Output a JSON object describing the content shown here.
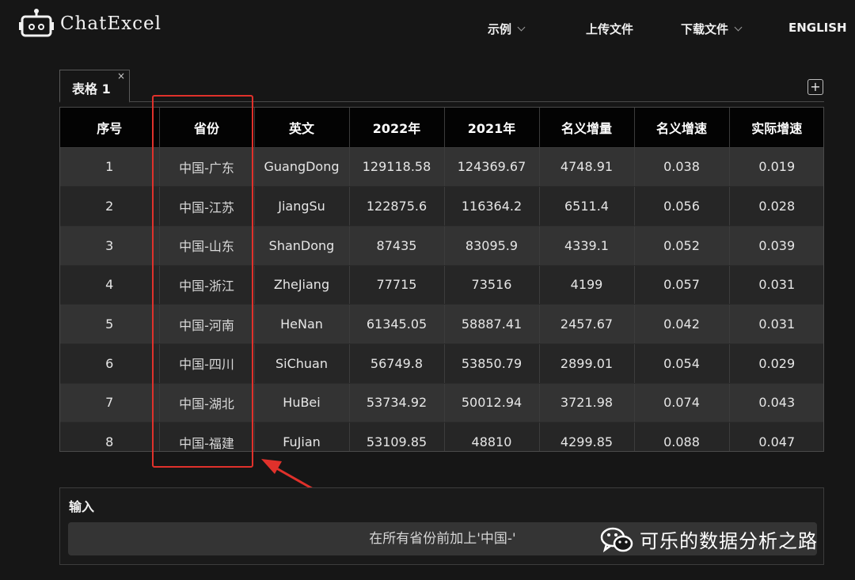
{
  "app": {
    "title": "ChatExcel"
  },
  "nav": {
    "examples": "示例",
    "upload": "上传文件",
    "download": "下载文件",
    "language": "ENGLISH"
  },
  "tabs": [
    {
      "label": "表格 1",
      "close": "×"
    }
  ],
  "add_tab": "+",
  "table": {
    "headers": [
      "序号",
      "省份",
      "英文",
      "2022年",
      "2021年",
      "名义增量",
      "名义增速",
      "实际增速"
    ],
    "rows": [
      [
        "1",
        "中国-广东",
        "GuangDong",
        "129118.58",
        "124369.67",
        "4748.91",
        "0.038",
        "0.019"
      ],
      [
        "2",
        "中国-江苏",
        "JiangSu",
        "122875.6",
        "116364.2",
        "6511.4",
        "0.056",
        "0.028"
      ],
      [
        "3",
        "中国-山东",
        "ShanDong",
        "87435",
        "83095.9",
        "4339.1",
        "0.052",
        "0.039"
      ],
      [
        "4",
        "中国-浙江",
        "ZheJiang",
        "77715",
        "73516",
        "4199",
        "0.057",
        "0.031"
      ],
      [
        "5",
        "中国-河南",
        "HeNan",
        "61345.05",
        "58887.41",
        "2457.67",
        "0.042",
        "0.031"
      ],
      [
        "6",
        "中国-四川",
        "SiChuan",
        "56749.8",
        "53850.79",
        "2899.01",
        "0.054",
        "0.029"
      ],
      [
        "7",
        "中国-湖北",
        "HuBei",
        "53734.92",
        "50012.94",
        "3721.98",
        "0.074",
        "0.043"
      ],
      [
        "8",
        "中国-福建",
        "FuJian",
        "53109.85",
        "48810",
        "4299.85",
        "0.088",
        "0.047"
      ]
    ]
  },
  "input": {
    "label": "输入",
    "value": "在所有省份前加上'中国-'"
  },
  "watermark": {
    "text": "可乐的数据分析之路"
  },
  "colors": {
    "highlight": "#e0312b",
    "background": "#161616",
    "header": "#030303"
  }
}
